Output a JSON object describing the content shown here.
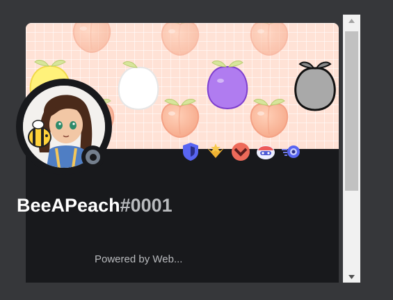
{
  "profile": {
    "username": "BeeAPeach",
    "discriminator": "#0001",
    "subtext": "Powered by Web..."
  },
  "status": {
    "state": "offline",
    "color": "#747f8d"
  },
  "badges": [
    {
      "name": "hypesquad-balance-icon",
      "color": "#5865f2"
    },
    {
      "name": "nitro-boost-icon",
      "color": "#f0b232"
    },
    {
      "name": "early-supporter-icon",
      "color": "#ed6a5a"
    },
    {
      "name": "discord-bot-icon",
      "color": "#5865f2"
    },
    {
      "name": "server-boost-icon",
      "color": "#4f5bd5"
    }
  ],
  "banner": {
    "background": "#ffe2d6",
    "fruits": [
      "peach",
      "lemon",
      "white-peach",
      "plum",
      "grey-peach"
    ]
  },
  "colors": {
    "card_bg": "#18191c",
    "username": "#ffffff",
    "discriminator": "#b9bbbe"
  }
}
